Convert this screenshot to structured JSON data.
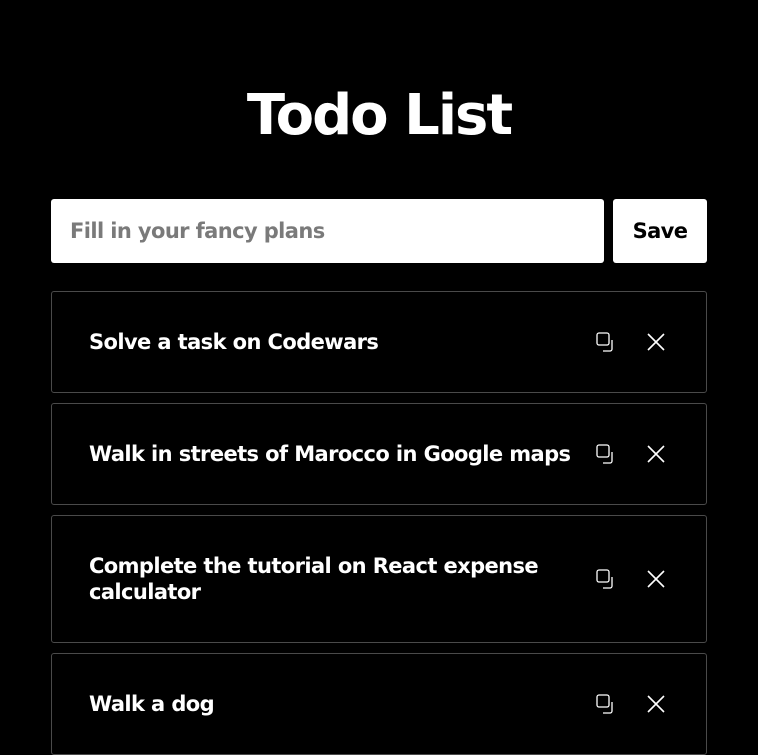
{
  "header": {
    "title": "Todo List"
  },
  "form": {
    "input_value": "",
    "input_placeholder": "Fill in your fancy plans",
    "save_label": "Save"
  },
  "todos": [
    {
      "text": "Solve a task on Codewars"
    },
    {
      "text": "Walk in streets of Marocco in Google maps"
    },
    {
      "text": "Complete the tutorial on React expense calculator"
    },
    {
      "text": "Walk a dog"
    }
  ],
  "icons": {
    "copy": "copy-icon",
    "delete": "close-icon"
  },
  "colors": {
    "background": "#000000",
    "text": "#ffffff",
    "item_border": "#4a4a4a",
    "input_background": "#ffffff",
    "placeholder": "#7a7a7a"
  }
}
